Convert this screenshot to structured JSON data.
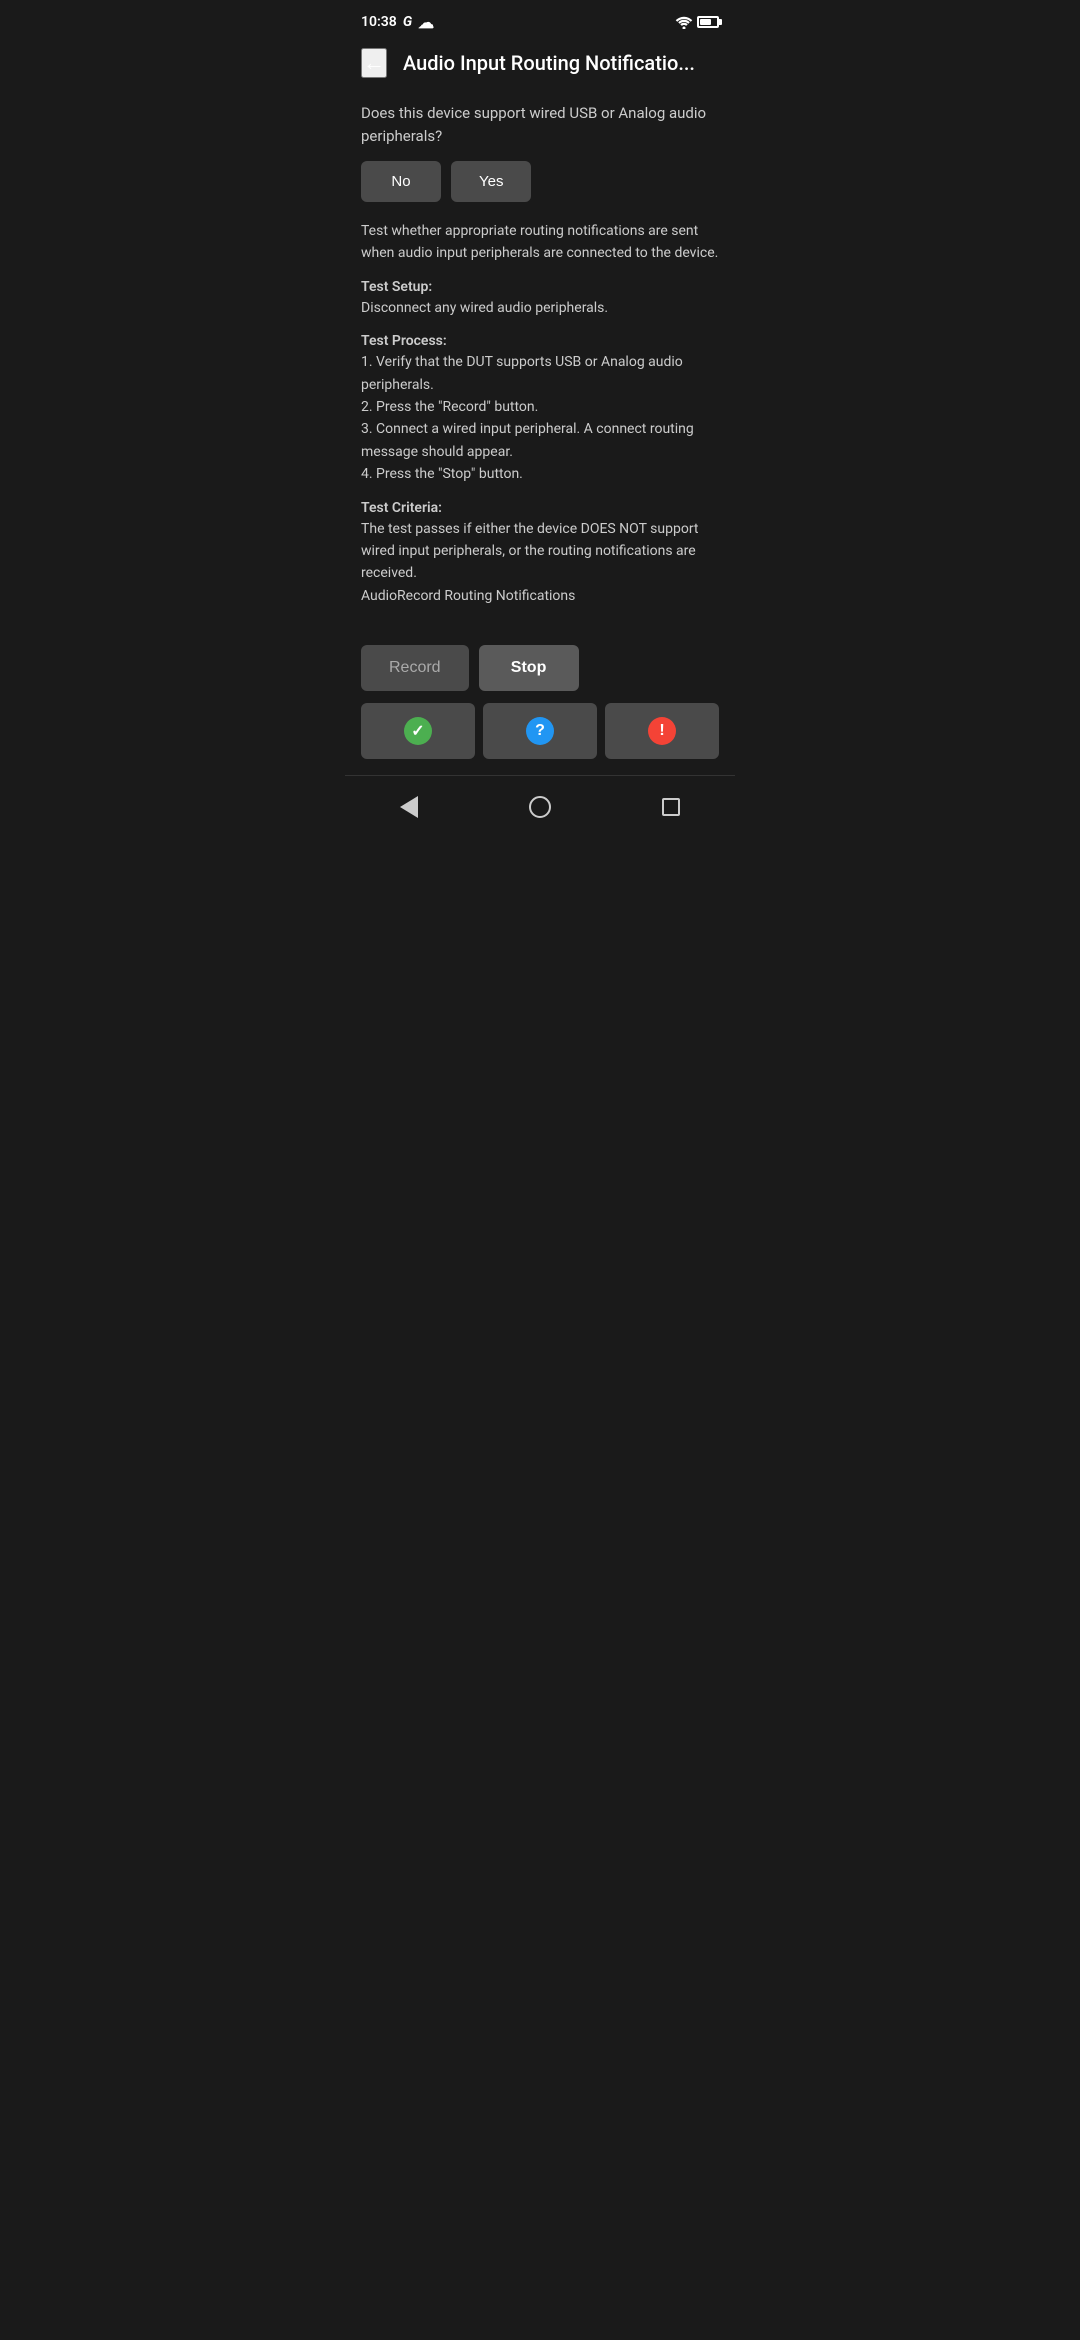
{
  "statusBar": {
    "time": "10:38",
    "googleLabel": "G",
    "cloudLabel": "☁"
  },
  "appBar": {
    "backLabel": "←",
    "title": "Audio Input Routing Notificatio..."
  },
  "content": {
    "questionText": "Does this device support wired USB or Analog audio peripherals?",
    "noLabel": "No",
    "yesLabel": "Yes",
    "descriptionText": "Test whether appropriate routing notifications are sent when audio input peripherals are connected to the device.",
    "setupHeading": "Test Setup:",
    "setupBody": "Disconnect any wired audio peripherals.",
    "processHeading": "Test Process:",
    "processBody": "1. Verify that the DUT supports USB or Analog audio peripherals.\n2. Press the \"Record\" button.\n3. Connect a wired input peripheral. A connect routing message should appear.\n4. Press the \"Stop\" button.",
    "criteriaHeading": "Test Criteria:",
    "criteriaBody": "The test passes if either the device DOES NOT support wired input peripherals, or the routing notifications are received.\nAudioRecord Routing Notifications"
  },
  "actionButtons": {
    "recordLabel": "Record",
    "stopLabel": "Stop"
  },
  "resultButtons": {
    "passIcon": "✓",
    "infoIcon": "?",
    "failIcon": "!"
  },
  "bottomNav": {
    "backLabel": "",
    "homeLabel": "",
    "recentLabel": ""
  }
}
